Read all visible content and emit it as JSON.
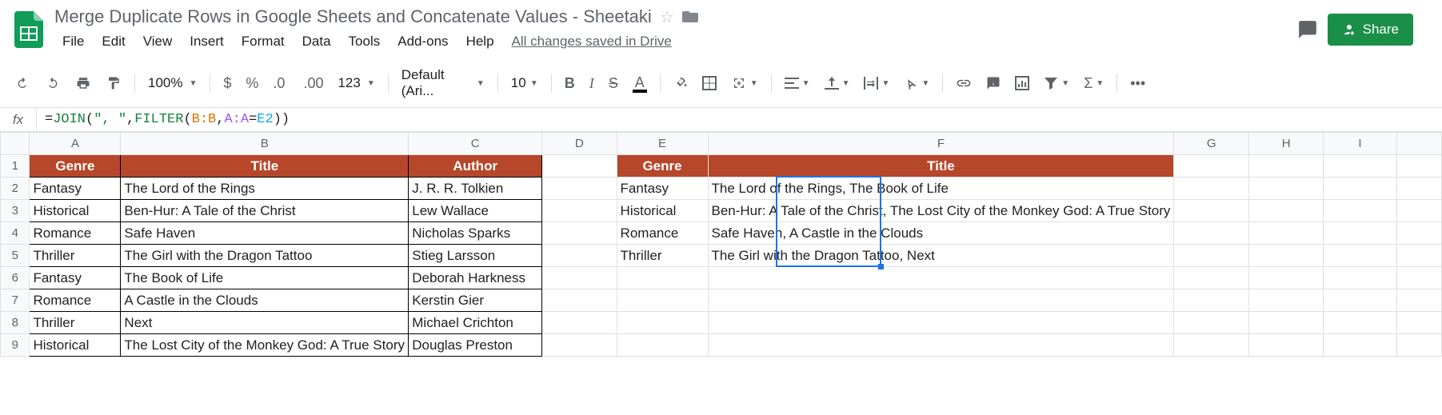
{
  "header": {
    "title": "Merge Duplicate Rows in Google Sheets and Concatenate Values - Sheetaki",
    "drive_status": "All changes saved in Drive",
    "share_label": "Share"
  },
  "menu": [
    "File",
    "Edit",
    "View",
    "Insert",
    "Format",
    "Data",
    "Tools",
    "Add-ons",
    "Help"
  ],
  "toolbar": {
    "zoom": "100%",
    "font": "Default (Ari...",
    "font_size": "10",
    "more": "123"
  },
  "formula": {
    "prefix": "=",
    "fn1": "JOIN",
    "arg_str": "\", \"",
    "fn2": "FILTER",
    "ref1": "B:B",
    "ref2": "A:A",
    "ref3": "E2"
  },
  "columns": [
    "A",
    "B",
    "C",
    "D",
    "E",
    "F",
    "G",
    "H",
    "I",
    ""
  ],
  "rows": [
    {
      "n": "1",
      "A": "Genre",
      "B": "Title",
      "C": "Author",
      "E": "Genre",
      "F": "Title",
      "hdr": true
    },
    {
      "n": "2",
      "A": "Fantasy",
      "B": "The Lord of the Rings",
      "C": " J. R. R. Tolkien",
      "E": "Fantasy",
      "F": "The Lord of the Rings, The Book of Life"
    },
    {
      "n": "3",
      "A": "Historical",
      "B": "Ben-Hur: A Tale of the Christ",
      "C": "Lew Wallace",
      "E": "Historical",
      "F": "Ben-Hur: A Tale of the Christ, The Lost City of the Monkey God: A True Story"
    },
    {
      "n": "4",
      "A": "Romance",
      "B": "Safe Haven",
      "C": "Nicholas Sparks",
      "E": "Romance",
      "F": "Safe Haven, A Castle in the Clouds"
    },
    {
      "n": "5",
      "A": "Thriller",
      "B": "The Girl with the Dragon Tattoo",
      "C": "Stieg Larsson",
      "E": "Thriller",
      "F": "The Girl with the Dragon Tattoo, Next"
    },
    {
      "n": "6",
      "A": "Fantasy",
      "B": "The Book of Life",
      "C": "Deborah Harkness"
    },
    {
      "n": "7",
      "A": "Romance",
      "B": "A Castle in the Clouds",
      "C": "Kerstin Gier"
    },
    {
      "n": "8",
      "A": "Thriller",
      "B": "Next",
      "C": "Michael Crichton"
    },
    {
      "n": "9",
      "A": "Historical",
      "B": "The Lost City of the Monkey God: A True Story",
      "C": "Douglas Preston"
    }
  ],
  "chart_data": {
    "type": "table",
    "title": "Books by Genre with merged titles",
    "source_table": {
      "columns": [
        "Genre",
        "Title",
        "Author"
      ],
      "rows": [
        [
          "Fantasy",
          "The Lord of the Rings",
          "J. R. R. Tolkien"
        ],
        [
          "Historical",
          "Ben-Hur: A Tale of the Christ",
          "Lew Wallace"
        ],
        [
          "Romance",
          "Safe Haven",
          "Nicholas Sparks"
        ],
        [
          "Thriller",
          "The Girl with the Dragon Tattoo",
          "Stieg Larsson"
        ],
        [
          "Fantasy",
          "The Book of Life",
          "Deborah Harkness"
        ],
        [
          "Romance",
          "A Castle in the Clouds",
          "Kerstin Gier"
        ],
        [
          "Thriller",
          "Next",
          "Michael Crichton"
        ],
        [
          "Historical",
          "The Lost City of the Monkey God: A True Story",
          "Douglas Preston"
        ]
      ]
    },
    "result_table": {
      "columns": [
        "Genre",
        "Title"
      ],
      "rows": [
        [
          "Fantasy",
          "The Lord of the Rings, The Book of Life"
        ],
        [
          "Historical",
          "Ben-Hur: A Tale of the Christ, The Lost City of the Monkey God: A True Story"
        ],
        [
          "Romance",
          "Safe Haven, A Castle in the Clouds"
        ],
        [
          "Thriller",
          "The Girl with the Dragon Tattoo, Next"
        ]
      ]
    }
  }
}
